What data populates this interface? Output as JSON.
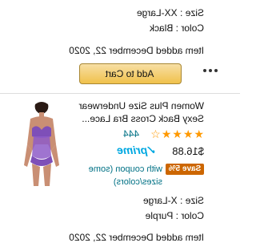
{
  "cart_items": [
    {
      "size": "Size : XX-Large",
      "color": "Color : Black",
      "added": "Item added December 22, 2020",
      "add_to_cart_label": "Add to Cart"
    },
    {
      "title_line1": "Women Plus Size Underwear",
      "title_line2": "Sexy Back Cross Bra Lace...",
      "stars": "★★★★☆",
      "rating_count": "444",
      "price": "$16.88",
      "prime": "✓prime",
      "save_badge": "Save 5%",
      "coupon_line1": "with coupon (some",
      "coupon_line2": "sizes/colors)",
      "size": "Size : X-Large",
      "color": "Color : Purple",
      "added": "Item added December 22, 2020"
    }
  ],
  "colors": {
    "star": "#ff9900",
    "prime": "#00a8e1",
    "link": "#007185",
    "save_badge": "#cc6600",
    "cart_button": "#f0c14b"
  },
  "icons": [
    "more-options-icon",
    "star-icon",
    "prime-icon"
  ]
}
